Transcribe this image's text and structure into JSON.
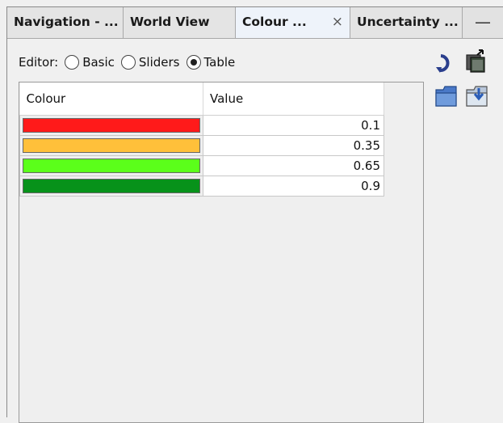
{
  "tabs": [
    {
      "label": "Navigation - ...",
      "active": false
    },
    {
      "label": "World View",
      "active": false
    },
    {
      "label": "Colour ...",
      "active": true,
      "close": "×"
    },
    {
      "label": "Uncertainty ...",
      "active": false
    }
  ],
  "minimize_label": "—",
  "editor": {
    "label": "Editor:",
    "options": [
      "Basic",
      "Sliders",
      "Table"
    ],
    "selected": "Table"
  },
  "toolbar_icons": [
    "refresh-icon",
    "copy-to-window-icon",
    "open-folder-icon",
    "save-icon"
  ],
  "table": {
    "headers": [
      "Colour",
      "Value"
    ],
    "rows": [
      {
        "colour": "#ff1a1a",
        "value": "0.1"
      },
      {
        "colour": "#ffc03a",
        "value": "0.35"
      },
      {
        "colour": "#5bff1a",
        "value": "0.65"
      },
      {
        "colour": "#07921a",
        "value": "0.9"
      }
    ]
  }
}
